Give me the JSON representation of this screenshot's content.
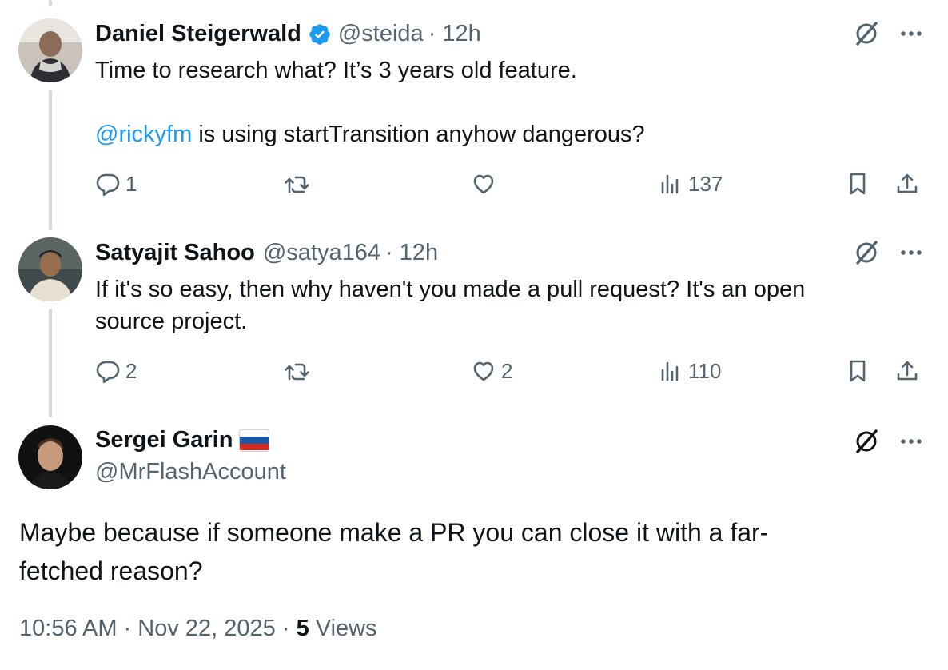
{
  "tweets": [
    {
      "name": "Daniel Steigerwald",
      "handle": "@steida",
      "time": "· 12h",
      "text_line1": "Time to research what? It’s 3 years old feature.",
      "mention": "@rickyfm",
      "text_line2_rest": " is using startTransition anyhow dangerous?",
      "replies": "1",
      "reposts": "",
      "likes": "",
      "views": "137"
    },
    {
      "name": "Satyajit Sahoo",
      "handle": "@satya164",
      "time": "· 12h",
      "text_line1": "If it's so easy, then why haven't you made a pull request? It's an open",
      "text_line2": "source project.",
      "replies": "2",
      "reposts": "",
      "likes": "2",
      "views": "110"
    }
  ],
  "main_tweet": {
    "name": "Sergei Garin",
    "handle": "@MrFlashAccount",
    "text_line1": "Maybe because if someone make a PR you can close it with a far-",
    "text_line2": "fetched reason?",
    "timestamp": "10:56 AM · Nov 22, 2025 ·",
    "views_count": "5",
    "views_label": "Views"
  },
  "icons": {
    "reply": "reply-icon",
    "repost": "repost-icon",
    "like": "heart-icon",
    "views": "views-icon",
    "bookmark": "bookmark-icon",
    "share": "share-icon",
    "grok": "grok-icon",
    "more": "more-icon",
    "verified": "verified-badge-icon",
    "flag": "russia-flag-icon"
  },
  "colors": {
    "text": "#0f1419",
    "secondary": "#536471",
    "link": "#1d9bf0",
    "thread_line": "#cfd9de"
  }
}
